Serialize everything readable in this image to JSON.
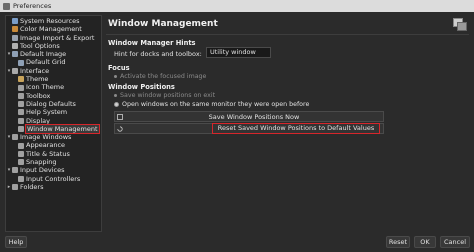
{
  "window": {
    "title": "Preferences"
  },
  "sidebar": {
    "items": [
      {
        "label": "System Resources",
        "level": 0,
        "arrow": "",
        "icon": "system-resources-icon",
        "icon_color": "#7a9cc7"
      },
      {
        "label": "Color Management",
        "level": 0,
        "arrow": "",
        "icon": "color-management-icon",
        "icon_color": "#c98a3a"
      },
      {
        "label": "Image Import & Export",
        "level": 0,
        "arrow": "",
        "icon": "image-import-export-icon",
        "icon_color": "#9aa3b0"
      },
      {
        "label": "Tool Options",
        "level": 0,
        "arrow": "",
        "icon": "tool-options-icon",
        "icon_color": "#b0b0b0"
      },
      {
        "label": "Default Image",
        "level": 0,
        "arrow": "v",
        "icon": "default-image-icon",
        "icon_color": "#8fa0b5"
      },
      {
        "label": "Default Grid",
        "level": 1,
        "arrow": "",
        "icon": "default-grid-icon",
        "icon_color": "#8fa0b5"
      },
      {
        "label": "Interface",
        "level": 0,
        "arrow": "v",
        "icon": "interface-icon",
        "icon_color": "#a9a9a9"
      },
      {
        "label": "Theme",
        "level": 1,
        "arrow": "",
        "icon": "theme-icon",
        "icon_color": "#c9a45b"
      },
      {
        "label": "Icon Theme",
        "level": 1,
        "arrow": "",
        "icon": "icon-theme-icon",
        "icon_color": "#a0a0a0"
      },
      {
        "label": "Toolbox",
        "level": 1,
        "arrow": "",
        "icon": "toolbox-icon",
        "icon_color": "#a0a0a0"
      },
      {
        "label": "Dialog Defaults",
        "level": 1,
        "arrow": "",
        "icon": "dialog-defaults-icon",
        "icon_color": "#a0a0a0"
      },
      {
        "label": "Help System",
        "level": 1,
        "arrow": "",
        "icon": "help-system-icon",
        "icon_color": "#a0a0a0"
      },
      {
        "label": "Display",
        "level": 1,
        "arrow": "",
        "icon": "display-icon",
        "icon_color": "#a0a0a0"
      },
      {
        "label": "Window Management",
        "level": 1,
        "arrow": "",
        "icon": "window-management-icon",
        "icon_color": "#a0a0a0",
        "selected": true
      },
      {
        "label": "Image Windows",
        "level": 0,
        "arrow": "v",
        "icon": "image-windows-icon",
        "icon_color": "#a0a0a0"
      },
      {
        "label": "Appearance",
        "level": 1,
        "arrow": "",
        "icon": "appearance-icon",
        "icon_color": "#a0a0a0"
      },
      {
        "label": "Title & Status",
        "level": 1,
        "arrow": "",
        "icon": "title-status-icon",
        "icon_color": "#a0a0a0"
      },
      {
        "label": "Snapping",
        "level": 1,
        "arrow": "",
        "icon": "snapping-icon",
        "icon_color": "#a0a0a0"
      },
      {
        "label": "Input Devices",
        "level": 0,
        "arrow": "v",
        "icon": "input-devices-icon",
        "icon_color": "#a0a0a0"
      },
      {
        "label": "Input Controllers",
        "level": 1,
        "arrow": "",
        "icon": "input-controllers-icon",
        "icon_color": "#a0a0a0"
      },
      {
        "label": "Folders",
        "level": 0,
        "arrow": ">",
        "icon": "folders-icon",
        "icon_color": "#a0a0a0"
      }
    ]
  },
  "page": {
    "title": "Window Management",
    "hints_section": "Window Manager Hints",
    "hints_label": "Hint for docks and toolbox:",
    "hints_value": "Utility window",
    "focus_section": "Focus",
    "focus_option": "Activate the focused image",
    "positions_section": "Window Positions",
    "save_on_exit": "Save window positions on exit",
    "open_same_monitor": "Open windows on the same monitor they were open before",
    "save_now_button": "Save Window Positions Now",
    "reset_button": "Reset Saved Window Positions to Default Values"
  },
  "buttons": {
    "help": "Help",
    "reset": "Reset",
    "ok": "OK",
    "cancel": "Cancel"
  },
  "colors": {
    "highlight": "#d6262b",
    "background": "#2b2b2b"
  }
}
